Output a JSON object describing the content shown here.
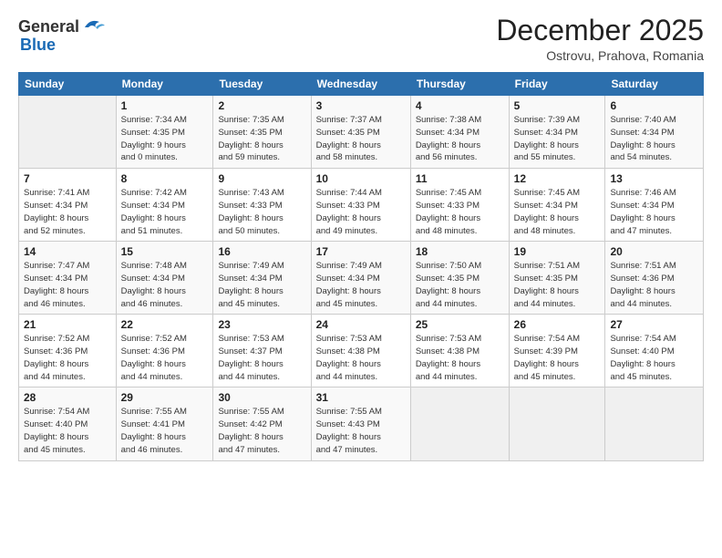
{
  "header": {
    "logo_general": "General",
    "logo_blue": "Blue",
    "month_title": "December 2025",
    "subtitle": "Ostrovu, Prahova, Romania"
  },
  "calendar": {
    "days_of_week": [
      "Sunday",
      "Monday",
      "Tuesday",
      "Wednesday",
      "Thursday",
      "Friday",
      "Saturday"
    ],
    "weeks": [
      [
        {
          "day": "",
          "info": ""
        },
        {
          "day": "1",
          "info": "Sunrise: 7:34 AM\nSunset: 4:35 PM\nDaylight: 9 hours\nand 0 minutes."
        },
        {
          "day": "2",
          "info": "Sunrise: 7:35 AM\nSunset: 4:35 PM\nDaylight: 8 hours\nand 59 minutes."
        },
        {
          "day": "3",
          "info": "Sunrise: 7:37 AM\nSunset: 4:35 PM\nDaylight: 8 hours\nand 58 minutes."
        },
        {
          "day": "4",
          "info": "Sunrise: 7:38 AM\nSunset: 4:34 PM\nDaylight: 8 hours\nand 56 minutes."
        },
        {
          "day": "5",
          "info": "Sunrise: 7:39 AM\nSunset: 4:34 PM\nDaylight: 8 hours\nand 55 minutes."
        },
        {
          "day": "6",
          "info": "Sunrise: 7:40 AM\nSunset: 4:34 PM\nDaylight: 8 hours\nand 54 minutes."
        }
      ],
      [
        {
          "day": "7",
          "info": "Sunrise: 7:41 AM\nSunset: 4:34 PM\nDaylight: 8 hours\nand 52 minutes."
        },
        {
          "day": "8",
          "info": "Sunrise: 7:42 AM\nSunset: 4:34 PM\nDaylight: 8 hours\nand 51 minutes."
        },
        {
          "day": "9",
          "info": "Sunrise: 7:43 AM\nSunset: 4:33 PM\nDaylight: 8 hours\nand 50 minutes."
        },
        {
          "day": "10",
          "info": "Sunrise: 7:44 AM\nSunset: 4:33 PM\nDaylight: 8 hours\nand 49 minutes."
        },
        {
          "day": "11",
          "info": "Sunrise: 7:45 AM\nSunset: 4:33 PM\nDaylight: 8 hours\nand 48 minutes."
        },
        {
          "day": "12",
          "info": "Sunrise: 7:45 AM\nSunset: 4:34 PM\nDaylight: 8 hours\nand 48 minutes."
        },
        {
          "day": "13",
          "info": "Sunrise: 7:46 AM\nSunset: 4:34 PM\nDaylight: 8 hours\nand 47 minutes."
        }
      ],
      [
        {
          "day": "14",
          "info": "Sunrise: 7:47 AM\nSunset: 4:34 PM\nDaylight: 8 hours\nand 46 minutes."
        },
        {
          "day": "15",
          "info": "Sunrise: 7:48 AM\nSunset: 4:34 PM\nDaylight: 8 hours\nand 46 minutes."
        },
        {
          "day": "16",
          "info": "Sunrise: 7:49 AM\nSunset: 4:34 PM\nDaylight: 8 hours\nand 45 minutes."
        },
        {
          "day": "17",
          "info": "Sunrise: 7:49 AM\nSunset: 4:34 PM\nDaylight: 8 hours\nand 45 minutes."
        },
        {
          "day": "18",
          "info": "Sunrise: 7:50 AM\nSunset: 4:35 PM\nDaylight: 8 hours\nand 44 minutes."
        },
        {
          "day": "19",
          "info": "Sunrise: 7:51 AM\nSunset: 4:35 PM\nDaylight: 8 hours\nand 44 minutes."
        },
        {
          "day": "20",
          "info": "Sunrise: 7:51 AM\nSunset: 4:36 PM\nDaylight: 8 hours\nand 44 minutes."
        }
      ],
      [
        {
          "day": "21",
          "info": "Sunrise: 7:52 AM\nSunset: 4:36 PM\nDaylight: 8 hours\nand 44 minutes."
        },
        {
          "day": "22",
          "info": "Sunrise: 7:52 AM\nSunset: 4:36 PM\nDaylight: 8 hours\nand 44 minutes."
        },
        {
          "day": "23",
          "info": "Sunrise: 7:53 AM\nSunset: 4:37 PM\nDaylight: 8 hours\nand 44 minutes."
        },
        {
          "day": "24",
          "info": "Sunrise: 7:53 AM\nSunset: 4:38 PM\nDaylight: 8 hours\nand 44 minutes."
        },
        {
          "day": "25",
          "info": "Sunrise: 7:53 AM\nSunset: 4:38 PM\nDaylight: 8 hours\nand 44 minutes."
        },
        {
          "day": "26",
          "info": "Sunrise: 7:54 AM\nSunset: 4:39 PM\nDaylight: 8 hours\nand 45 minutes."
        },
        {
          "day": "27",
          "info": "Sunrise: 7:54 AM\nSunset: 4:40 PM\nDaylight: 8 hours\nand 45 minutes."
        }
      ],
      [
        {
          "day": "28",
          "info": "Sunrise: 7:54 AM\nSunset: 4:40 PM\nDaylight: 8 hours\nand 45 minutes."
        },
        {
          "day": "29",
          "info": "Sunrise: 7:55 AM\nSunset: 4:41 PM\nDaylight: 8 hours\nand 46 minutes."
        },
        {
          "day": "30",
          "info": "Sunrise: 7:55 AM\nSunset: 4:42 PM\nDaylight: 8 hours\nand 47 minutes."
        },
        {
          "day": "31",
          "info": "Sunrise: 7:55 AM\nSunset: 4:43 PM\nDaylight: 8 hours\nand 47 minutes."
        },
        {
          "day": "",
          "info": ""
        },
        {
          "day": "",
          "info": ""
        },
        {
          "day": "",
          "info": ""
        }
      ]
    ]
  }
}
